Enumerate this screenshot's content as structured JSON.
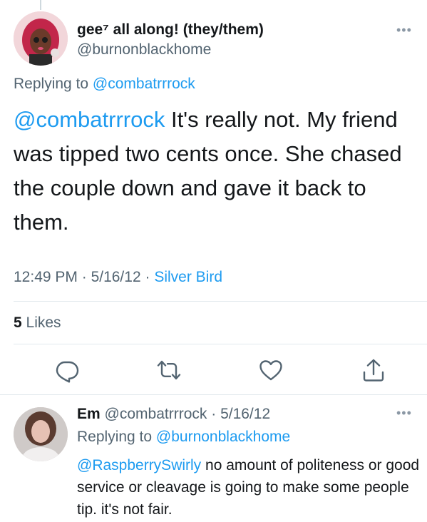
{
  "main_tweet": {
    "display_name": "gee⁷ all along! (they/them)",
    "handle": "@burnonblackhome",
    "replying_prefix": "Replying to",
    "replying_to": "@combatrrrock",
    "text_mention": "@combatrrrock",
    "text_body": " It's really not. My friend was tipped two cents once. She chased the couple down and gave it back to them.",
    "time": "12:49 PM",
    "date": "5/16/12",
    "source": "Silver Bird",
    "likes_count": "5",
    "likes_label": "Likes",
    "more_icon": "more-icon",
    "actions": [
      "reply-icon",
      "retweet-icon",
      "like-icon",
      "share-icon"
    ]
  },
  "reply_tweet": {
    "display_name": "Em",
    "handle": "@combatrrrock",
    "date": "5/16/12",
    "replying_prefix": "Replying to",
    "replying_to": "@burnonblackhome",
    "text_mention": "@RaspberrySwirly",
    "text_body": " no amount of politeness or good service or cleavage is going to make some people tip. it's not fair.",
    "more_icon": "more-icon"
  },
  "colors": {
    "link": "#1d9bf0",
    "secondary_text": "#536471",
    "primary_text": "#14171a",
    "divider": "#e1e8ed"
  }
}
